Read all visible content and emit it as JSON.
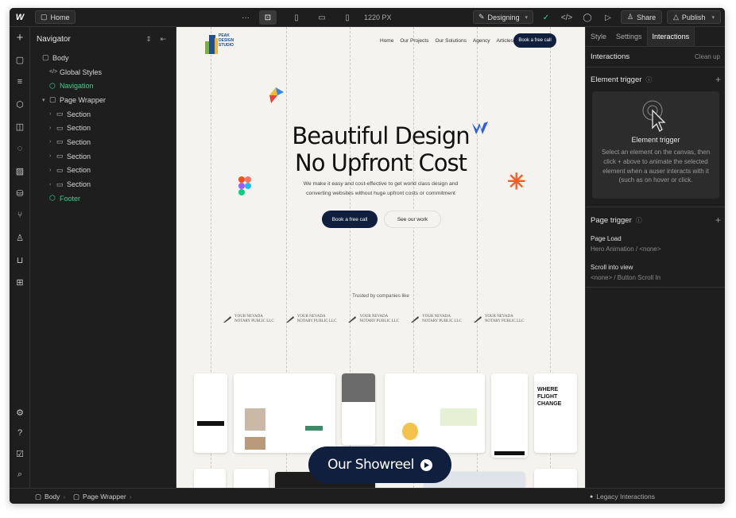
{
  "topbar": {
    "logo": "W",
    "home_label": "Home",
    "more": "···",
    "viewport": "1220 PX",
    "mode_label": "Designing",
    "share_label": "Share",
    "publish_label": "Publish"
  },
  "navigator": {
    "title": "Navigator",
    "items": [
      {
        "label": "Body",
        "indent": 0,
        "icon": "box-icon",
        "caret": "",
        "green": false
      },
      {
        "label": "Global Styles",
        "indent": 1,
        "icon": "code-icon",
        "caret": "",
        "green": false
      },
      {
        "label": "Navigation",
        "indent": 1,
        "icon": "component-icon",
        "caret": "",
        "green": true
      },
      {
        "label": "Page Wrapper",
        "indent": 1,
        "icon": "box-icon",
        "caret": "v",
        "green": false
      },
      {
        "label": "Section",
        "indent": 2,
        "icon": "section-icon",
        "caret": ">",
        "green": false
      },
      {
        "label": "Section",
        "indent": 2,
        "icon": "section-icon",
        "caret": ">",
        "green": false
      },
      {
        "label": "Section",
        "indent": 2,
        "icon": "section-icon",
        "caret": ">",
        "green": false
      },
      {
        "label": "Section",
        "indent": 2,
        "icon": "section-icon",
        "caret": ">",
        "green": false
      },
      {
        "label": "Section",
        "indent": 2,
        "icon": "section-icon",
        "caret": ">",
        "green": false
      },
      {
        "label": "Section",
        "indent": 2,
        "icon": "section-icon",
        "caret": ">",
        "green": false
      },
      {
        "label": "Footer",
        "indent": 1,
        "icon": "component-icon",
        "caret": "",
        "green": true
      }
    ]
  },
  "site": {
    "logo_text": [
      "PEAK",
      "DESIGN",
      "STUDIO"
    ],
    "nav": [
      "Home",
      "Our Projects",
      "Our Solutions",
      "Agency",
      "Articles"
    ],
    "cta": "Book a free call",
    "hero_line1": "Beautiful Design",
    "hero_line2": "No Upfront Cost",
    "hero_sub": "We make it easy and cost-effective to get world class design and converting websites without huge upfront costs or commitment",
    "primary_btn": "Book a free call",
    "secondary_btn": "See our work",
    "trusted": "Trusted by companies like",
    "logo_line1": "YOUR NEVADA",
    "logo_line2": "NOTARY PUBLIC LLC",
    "showreel": "Our Showreel"
  },
  "right_panel": {
    "tabs": [
      "Style",
      "Settings",
      "Interactions"
    ],
    "header": "Interactions",
    "clean_up": "Clean up",
    "element_trigger_title": "Element trigger",
    "card_title": "Element trigger",
    "card_desc": "Select an element on the canvas, then click + above to animate the selected element when a auser interacts with it (such as on hover or click.",
    "page_trigger_title": "Page trigger",
    "page_triggers": [
      {
        "name": "Page Load",
        "value": "Hero Animation / <none>"
      },
      {
        "name": "Scroll into view",
        "value": "<none> / Button Scroll In"
      }
    ]
  },
  "bottombar": {
    "crumbs": [
      "Body",
      "Page Wrapper"
    ],
    "legacy": "Legacy Interactions"
  },
  "colors": {
    "accent_green": "#3ecf8e",
    "navy": "#0f1f3d",
    "canvas_bg": "#f4f3ef",
    "panel_bg": "#1e1e1e"
  }
}
